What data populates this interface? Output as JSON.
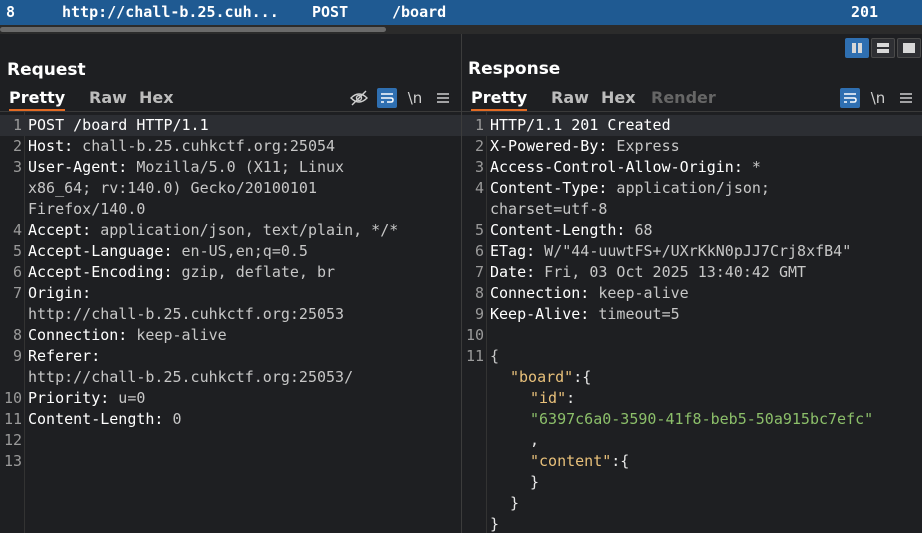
{
  "history_row": {
    "number": "8",
    "host": "http://chall-b.25.cuh...",
    "method": "POST",
    "path": "/board",
    "status": "201"
  },
  "request": {
    "title": "Request",
    "tabs": [
      "Pretty",
      "Raw",
      "Hex"
    ],
    "active_tab": "Pretty",
    "tools": {
      "hide_icon": "eye-slash-icon",
      "wrap_icon": "wrap-lines-icon",
      "newline_label": "\\n",
      "menu_icon": "hamburger-icon"
    },
    "lines": [
      {
        "n": "1",
        "key": "POST /board HTTP/1.1",
        "val": ""
      },
      {
        "n": "2",
        "key": "Host:",
        "val": " chall-b.25.cuhkctf.org:25054"
      },
      {
        "n": "3",
        "key": "User-Agent:",
        "val": " Mozilla/5.0 (X11; Linux"
      },
      {
        "n": "",
        "key": "",
        "val": "x86_64; rv:140.0) Gecko/20100101"
      },
      {
        "n": "",
        "key": "",
        "val": "Firefox/140.0"
      },
      {
        "n": "4",
        "key": "Accept:",
        "val": " application/json, text/plain, */*"
      },
      {
        "n": "5",
        "key": "Accept-Language:",
        "val": " en-US,en;q=0.5"
      },
      {
        "n": "6",
        "key": "Accept-Encoding:",
        "val": " gzip, deflate, br"
      },
      {
        "n": "7",
        "key": "Origin:",
        "val": ""
      },
      {
        "n": "",
        "key": "",
        "val": "http://chall-b.25.cuhkctf.org:25053"
      },
      {
        "n": "8",
        "key": "Connection:",
        "val": " keep-alive"
      },
      {
        "n": "9",
        "key": "Referer:",
        "val": ""
      },
      {
        "n": "",
        "key": "",
        "val": "http://chall-b.25.cuhkctf.org:25053/"
      },
      {
        "n": "10",
        "key": "Priority:",
        "val": " u=0"
      },
      {
        "n": "11",
        "key": "Content-Length:",
        "val": " 0"
      },
      {
        "n": "12",
        "key": "",
        "val": ""
      },
      {
        "n": "13",
        "key": "",
        "val": ""
      }
    ]
  },
  "response": {
    "title": "Response",
    "tabs": [
      "Pretty",
      "Raw",
      "Hex",
      "Render"
    ],
    "active_tab": "Pretty",
    "tools": {
      "wrap_icon": "wrap-lines-icon",
      "newline_label": "\\n",
      "menu_icon": "hamburger-icon"
    },
    "lines": [
      {
        "n": "1",
        "key": "HTTP/1.1 201 Created",
        "val": ""
      },
      {
        "n": "2",
        "key": "X-Powered-By:",
        "val": " Express"
      },
      {
        "n": "3",
        "key": "Access-Control-Allow-Origin:",
        "val": " *"
      },
      {
        "n": "4",
        "key": "Content-Type:",
        "val": " application/json;"
      },
      {
        "n": "",
        "key": "",
        "val": "charset=utf-8"
      },
      {
        "n": "5",
        "key": "Content-Length:",
        "val": " 68"
      },
      {
        "n": "6",
        "key": "ETag:",
        "val": " W/\"44-uuwtFS+/UXrKkN0pJJ7Crj8xfB4\""
      },
      {
        "n": "7",
        "key": "Date:",
        "val": " Fri, 03 Oct 2025 13:40:42 GMT"
      },
      {
        "n": "8",
        "key": "Connection:",
        "val": " keep-alive"
      },
      {
        "n": "9",
        "key": "Keep-Alive:",
        "val": " timeout=5"
      },
      {
        "n": "10",
        "key": "",
        "val": ""
      },
      {
        "n": "11",
        "key": "",
        "val": "{"
      }
    ],
    "json_lines": [
      {
        "indent": 1,
        "k": "\"board\"",
        "rest": ":{"
      },
      {
        "indent": 2,
        "k": "\"id\"",
        "rest": ":"
      },
      {
        "indent": 2,
        "s": "\"6397c6a0-3590-41f8-beb5-50a915bc7efc\"",
        "rest": ""
      },
      {
        "indent": 2,
        "k": "",
        "rest": ","
      },
      {
        "indent": 2,
        "k": "\"content\"",
        "rest": ":{"
      },
      {
        "indent": 2,
        "k": "",
        "rest": "}"
      },
      {
        "indent": 1,
        "k": "",
        "rest": "}"
      },
      {
        "indent": 0,
        "k": "",
        "rest": "}"
      }
    ]
  },
  "layout_toggle": {
    "options": [
      "side-by-side-icon",
      "stacked-icon",
      "single-pane-icon"
    ],
    "active": "side-by-side-icon"
  }
}
